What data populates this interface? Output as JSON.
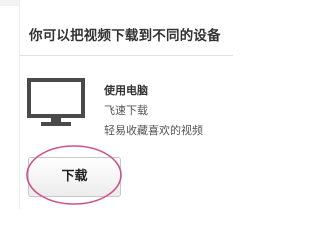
{
  "panel": {
    "title": "你可以把视频下载到不同的设备",
    "device": {
      "name": "使用电脑",
      "icon": "monitor-icon",
      "features": [
        "飞速下载",
        "轻易收藏喜欢的视频"
      ]
    },
    "download_label": "下载"
  },
  "colors": {
    "highlight_ring": "#d0508a",
    "monitor": "#4a4a4a"
  }
}
